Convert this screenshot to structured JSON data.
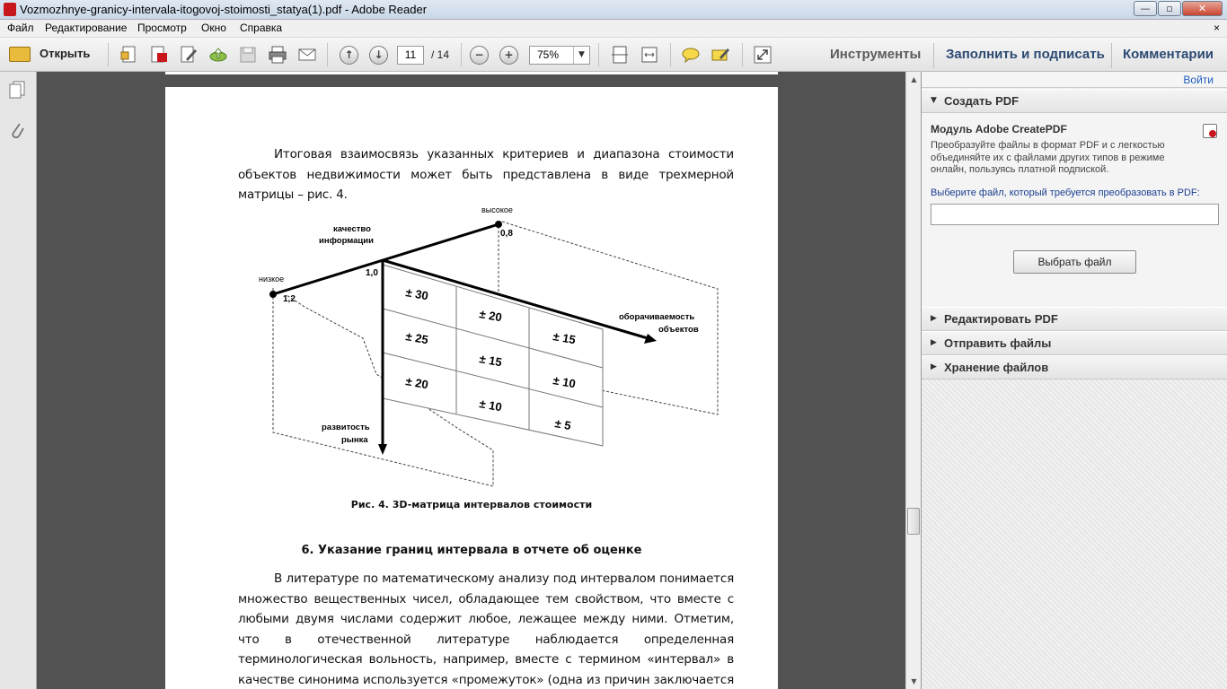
{
  "window": {
    "title": "Vozmozhnye-granicy-intervala-itogovoj-stoimosti_statya(1).pdf - Adobe Reader",
    "min": "—",
    "max": "▫",
    "close": "✕"
  },
  "menu": [
    "Файл",
    "Редактирование",
    "Просмотр",
    "Окно",
    "Справка"
  ],
  "menu_close": "×",
  "toolbar": {
    "open_label": "Открыть",
    "page_current": "11",
    "page_total": "/ 14",
    "zoom": "75%",
    "tools": "Инструменты",
    "fill_sign": "Заполнить и подписать",
    "comments": "Комментарии"
  },
  "document": {
    "para1": "Итоговая взаимосвязь указанных критериев и диапазона стоимости объектов недвижимости может быть представлена в виде трехмерной матрицы – рис. 4.",
    "figure": {
      "label_high": "высокое",
      "label_low": "низкое",
      "label_quality_1": "качество",
      "label_quality_2": "информации",
      "label_turnover_1": "оборачиваемость",
      "label_turnover_2": "объектов",
      "label_market_1": "развитость",
      "label_market_2": "рынка",
      "val_08": "0,8",
      "val_10": "1,0",
      "val_12": "1,2",
      "cells": [
        "± 30",
        "± 20",
        "± 15",
        "± 25",
        "± 15",
        "± 10",
        "± 20",
        "± 10",
        "± 5"
      ]
    },
    "caption": "Рис. 4. 3D-матрица интервалов стоимости",
    "heading": "6. Указание границ интервала в отчете об оценке",
    "para2": "В литературе по математическому анализу под интервалом понимается множество вещественных чисел, обладающее тем свойством, что вместе с любыми двумя числами содержит любое, лежащее между ними. Отметим, что в отечественной литературе наблюдается определенная терминологическая вольность, например, вместе с термином «интервал» в качестве синонима используется «промежуток» (одна из причин заключается в том, что в"
  },
  "rightpane": {
    "login": "Войти",
    "create_pdf": "Создать PDF",
    "module_title": "Модуль Adobe CreatePDF",
    "module_desc": "Преобразуйте файлы в формат PDF и с легкостью объединяйте их с файлами других типов в режиме онлайн, пользуясь платной подпиской.",
    "choose_label": "Выберите файл, который требуется преобразовать в PDF:",
    "choose_button": "Выбрать файл",
    "edit_pdf": "Редактировать PDF",
    "send_files": "Отправить файлы",
    "store_files": "Хранение файлов"
  },
  "colors": {
    "accent_link": "#2c4a73",
    "doc_bg": "#525252",
    "close_red": "#c8462e"
  }
}
